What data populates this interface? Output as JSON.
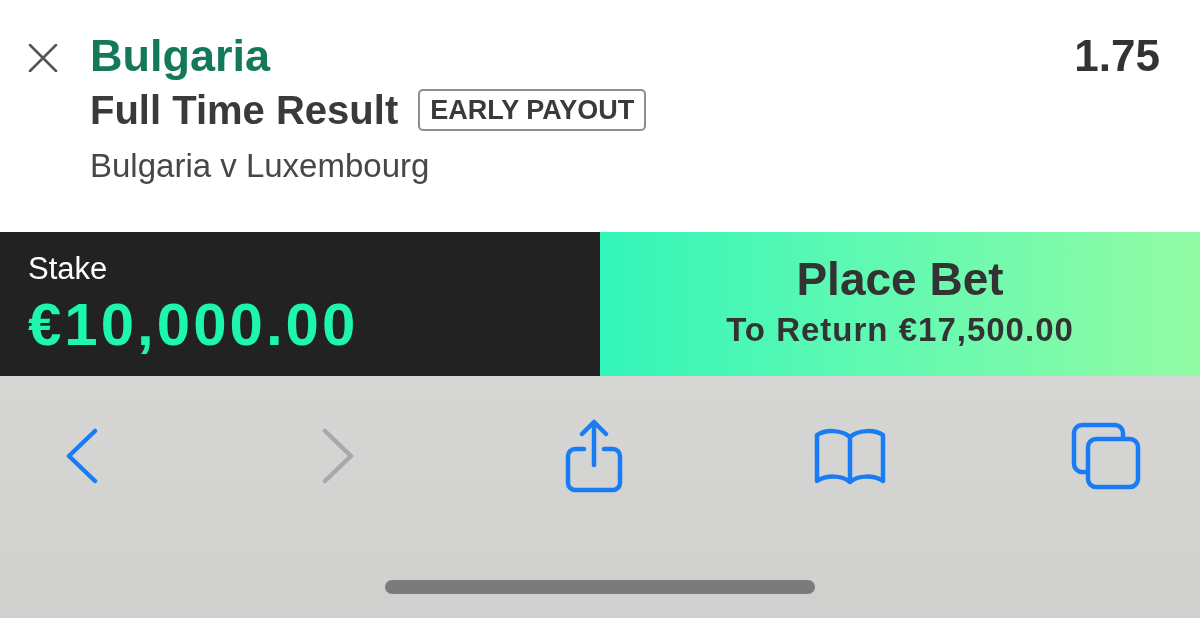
{
  "bet": {
    "selection": "Bulgaria",
    "odds": "1.75",
    "market": "Full Time Result",
    "badge": "EARLY PAYOUT",
    "event": "Bulgaria v Luxembourg"
  },
  "bet_bar": {
    "stake_label": "Stake",
    "stake_value": "€10,000.00",
    "button_label": "Place Bet",
    "return_label": "To Return €17,500.00"
  },
  "browser_toolbar": {
    "buttons": [
      {
        "kind": "back",
        "disabled": false
      },
      {
        "kind": "forward",
        "disabled": true
      },
      {
        "kind": "share",
        "disabled": false
      },
      {
        "kind": "bookmarks",
        "disabled": false
      },
      {
        "kind": "tabs",
        "disabled": false
      }
    ]
  }
}
